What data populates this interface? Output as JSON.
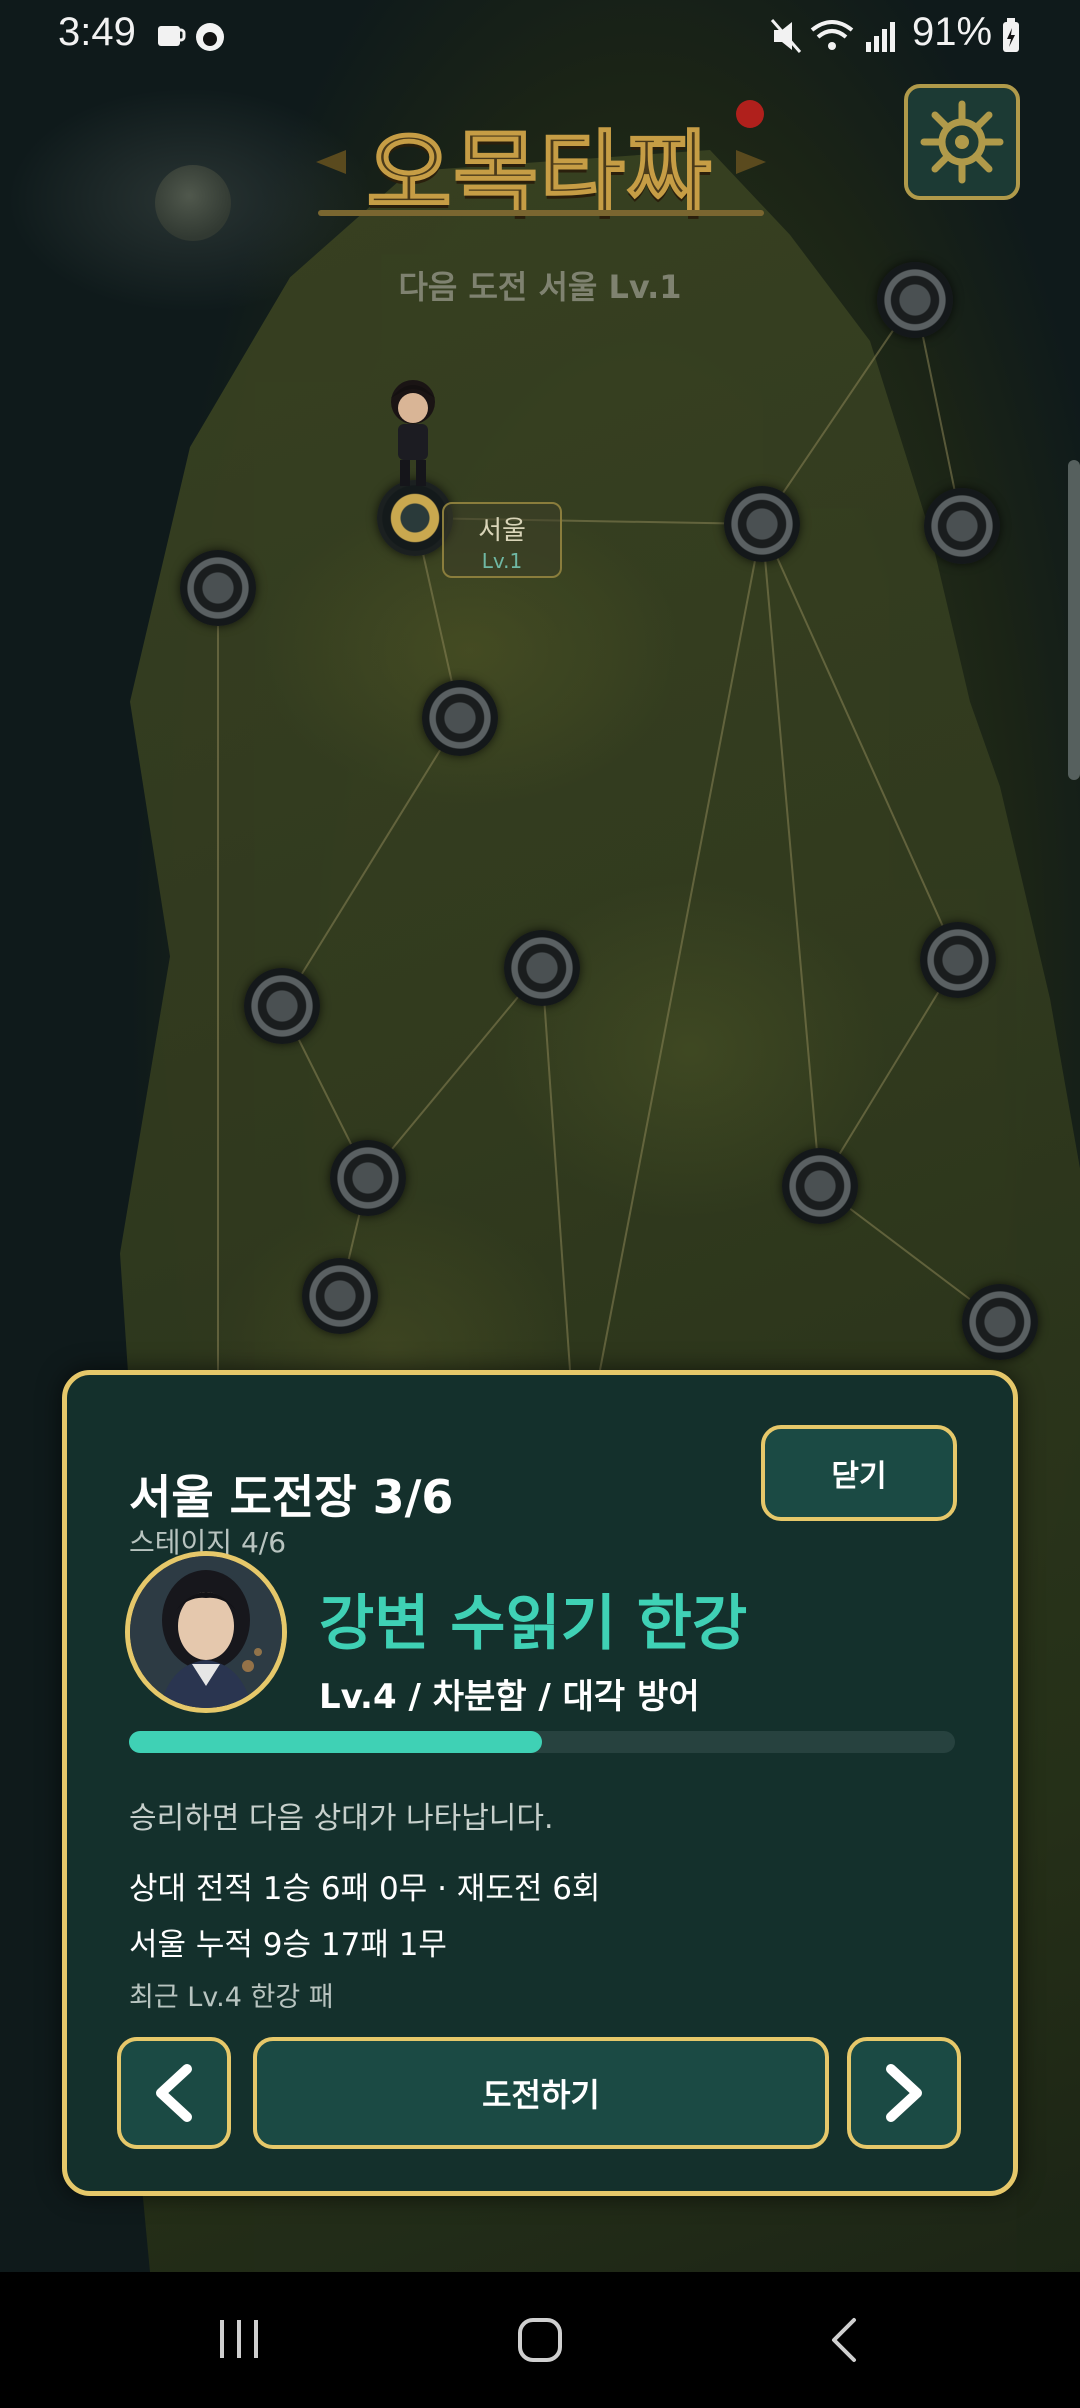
{
  "status_bar": {
    "time": "3:49",
    "battery": "91%"
  },
  "header": {
    "logo_text": "오목타짜",
    "next_challenge": "다음 도전  서울 Lv.1"
  },
  "map": {
    "current_city": {
      "name": "서울",
      "level": "Lv.1"
    }
  },
  "card": {
    "title": "서울 도전장 3/6",
    "stage": "스테이지 4/6",
    "close_label": "닫기",
    "opponent_name": "강변 수읽기 한강",
    "opponent_meta": "Lv.4 / 차분함 / 대각 방어",
    "progress": 0.5,
    "win_note": "승리하면 다음 상대가 나타납니다.",
    "record_vs": "상대 전적 1승 6패 0무 · 재도전 6회",
    "record_city": "서울 누적 9승 17패 1무",
    "recent": "최근 Lv.4 한강 패",
    "challenge_label": "도전하기"
  },
  "colors": {
    "accent": "#3fd1b5",
    "gold": "#e6c86a",
    "panel": "#14302c"
  }
}
